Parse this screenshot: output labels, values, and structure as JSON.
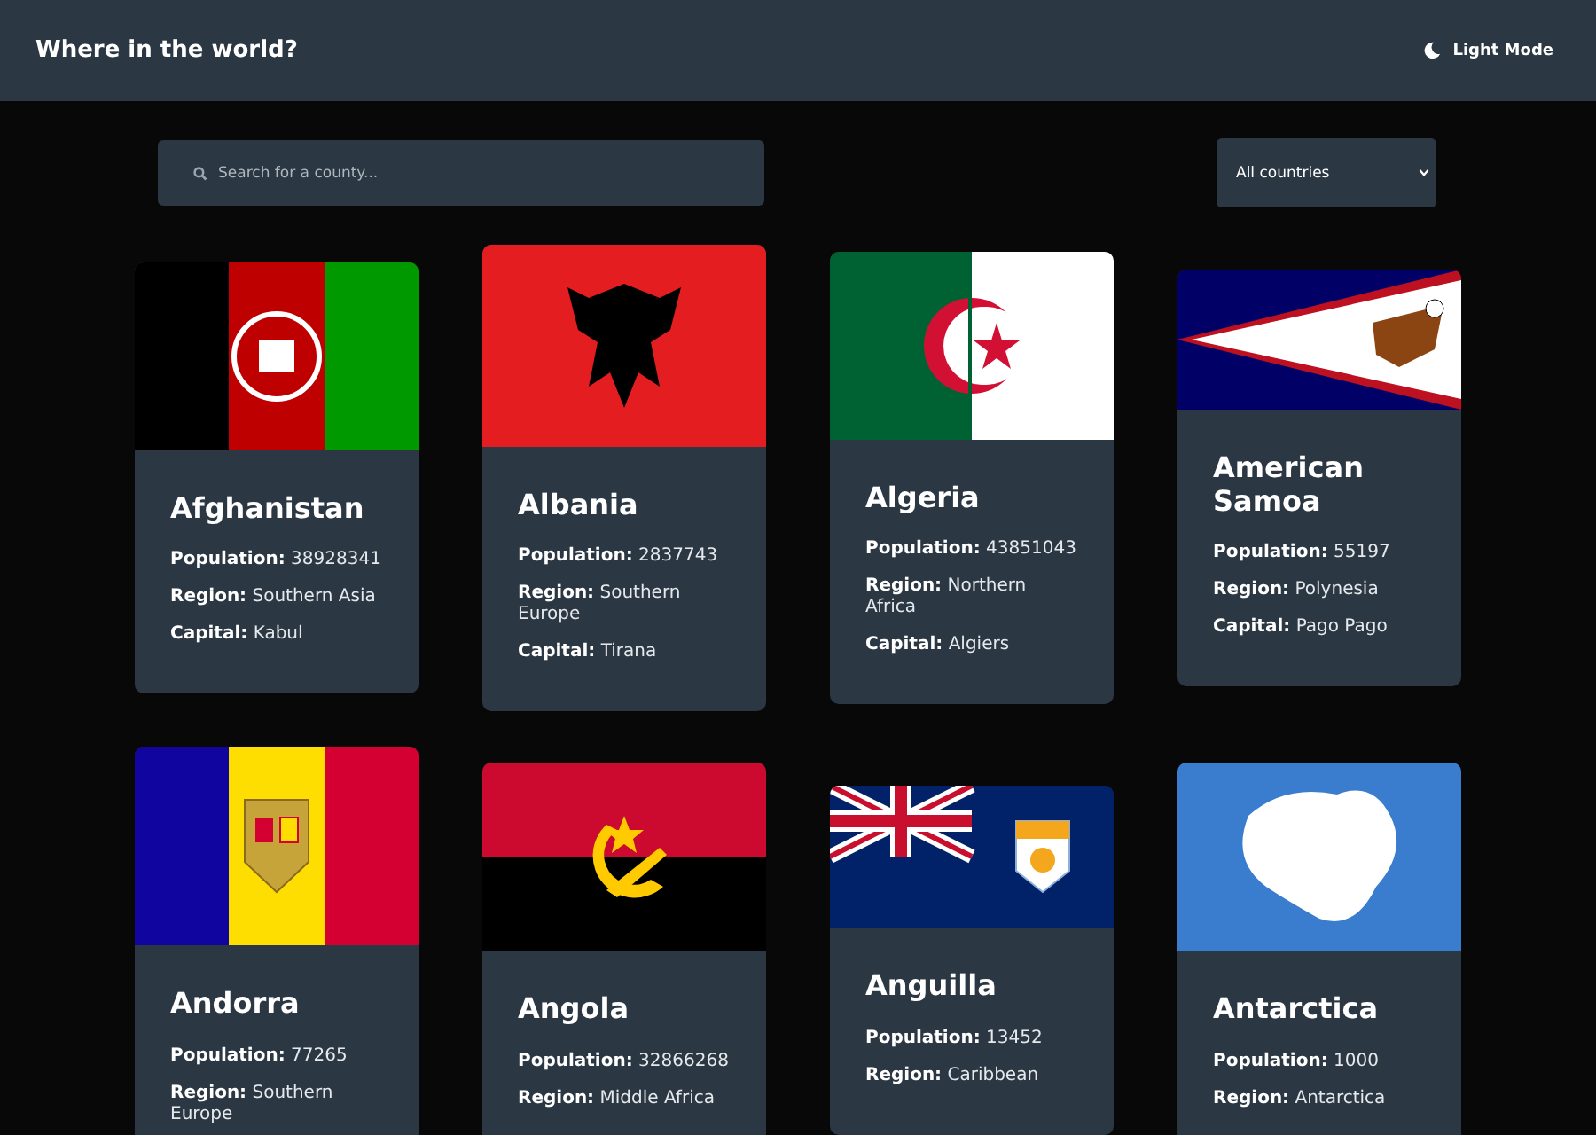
{
  "header": {
    "title": "Where in the world?",
    "theme_toggle": "Light Mode"
  },
  "search": {
    "placeholder": "Search for a county..."
  },
  "filter": {
    "value": "All countries"
  },
  "countries": [
    {
      "name": "Afghanistan",
      "fields": [
        {
          "label": "Population:",
          "value": "38928341"
        },
        {
          "label": "Region:",
          "value": "Southern Asia"
        },
        {
          "label": "Capital:",
          "value": "Kabul"
        }
      ]
    },
    {
      "name": "Albania",
      "fields": [
        {
          "label": "Population:",
          "value": "2837743"
        },
        {
          "label": "Region:",
          "value": "Southern Europe"
        },
        {
          "label": "Capital:",
          "value": "Tirana"
        }
      ]
    },
    {
      "name": "Algeria",
      "fields": [
        {
          "label": "Population:",
          "value": "43851043"
        },
        {
          "label": "Region:",
          "value": "Northern Africa"
        },
        {
          "label": "Capital:",
          "value": "Algiers"
        }
      ]
    },
    {
      "name": "American Samoa",
      "fields": [
        {
          "label": "Population:",
          "value": "55197"
        },
        {
          "label": "Region:",
          "value": "Polynesia"
        },
        {
          "label": "Capital:",
          "value": "Pago Pago"
        }
      ]
    },
    {
      "name": "Andorra",
      "fields": [
        {
          "label": "Population:",
          "value": "77265"
        },
        {
          "label": "Region:",
          "value": "Southern Europe"
        }
      ]
    },
    {
      "name": "Angola",
      "fields": [
        {
          "label": "Population:",
          "value": "32866268"
        },
        {
          "label": "Region:",
          "value": "Middle Africa"
        }
      ]
    },
    {
      "name": "Anguilla",
      "fields": [
        {
          "label": "Population:",
          "value": "13452"
        },
        {
          "label": "Region:",
          "value": "Caribbean"
        }
      ]
    },
    {
      "name": "Antarctica",
      "fields": [
        {
          "label": "Population:",
          "value": "1000"
        },
        {
          "label": "Region:",
          "value": "Antarctica"
        }
      ]
    }
  ]
}
